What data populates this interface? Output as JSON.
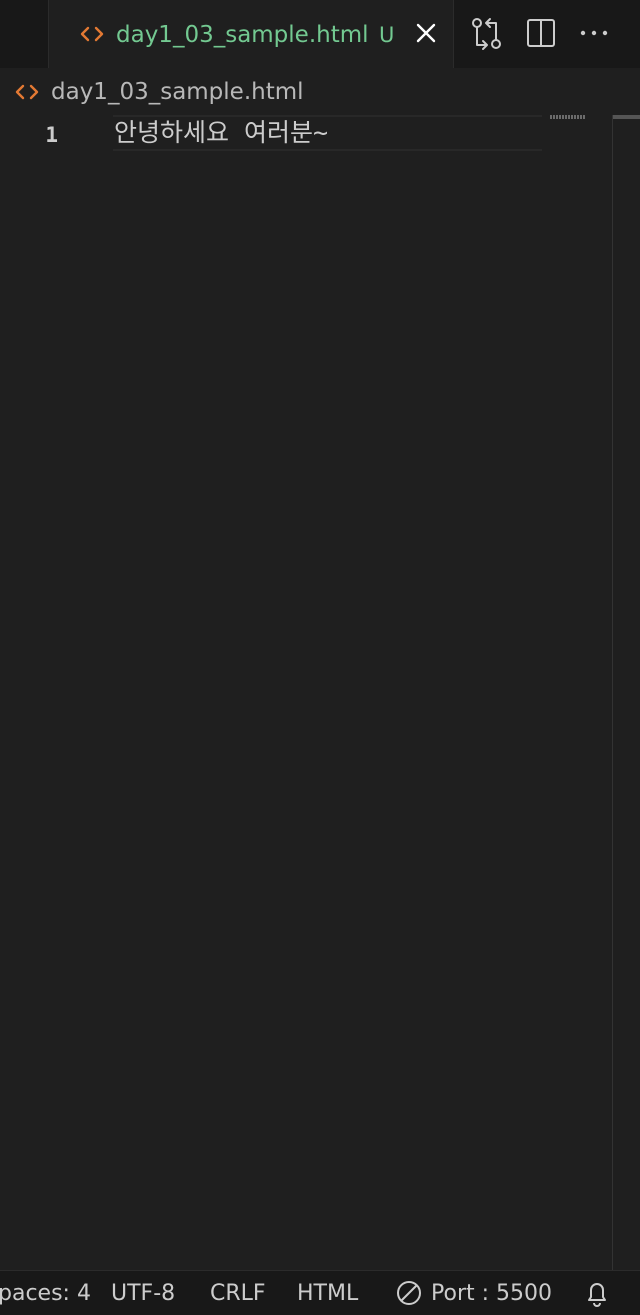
{
  "tab": {
    "filename": "day1_03_sample.html",
    "git_status": "U",
    "file_icon": "code-brackets-icon"
  },
  "breadcrumb": {
    "filename": "day1_03_sample.html",
    "file_icon": "code-brackets-icon"
  },
  "editor": {
    "lines": [
      {
        "number": "1",
        "text": "안녕하세요 여러분~"
      }
    ]
  },
  "status_bar": {
    "indentation": "paces: 4",
    "encoding": "UTF-8",
    "line_ending": "CRLF",
    "language": "HTML",
    "live_server": "Port : 5500"
  },
  "colors": {
    "html_icon": "#e37933",
    "untracked": "#73c991",
    "background": "#1f1f1f",
    "chrome": "#181818"
  }
}
